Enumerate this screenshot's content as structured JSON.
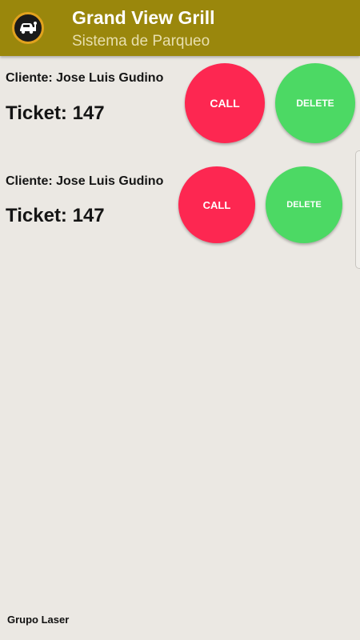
{
  "header": {
    "title": "Grand View Grill",
    "subtitle": "Sistema de Parqueo",
    "icon": "car-service-icon",
    "color": "#9a870c"
  },
  "tickets": [
    {
      "client": "Cliente: Jose Luis Gudino",
      "ticket": "Ticket: 147",
      "call_label": "CALL",
      "delete_label": "DELETE"
    },
    {
      "client": "Cliente: Jose Luis Gudino",
      "ticket": "Ticket: 147",
      "call_label": "CALL",
      "delete_label": "DELETE"
    }
  ],
  "colors": {
    "call": "#fd2751",
    "delete": "#4cd964",
    "background": "#ebe8e3"
  },
  "footer": {
    "label": "Grupo Laser"
  }
}
